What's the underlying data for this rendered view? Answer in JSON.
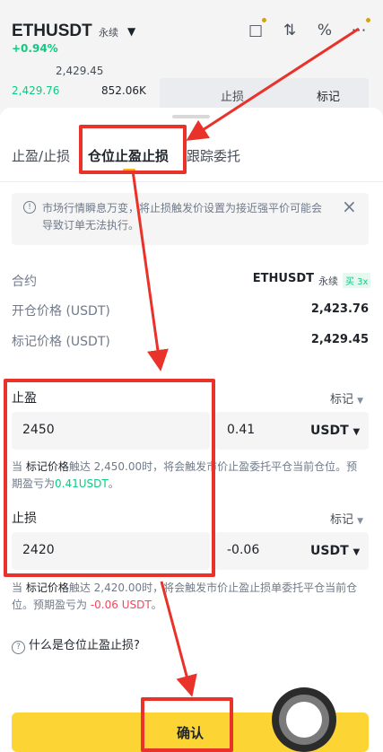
{
  "background": {
    "pair": "ETHUSDT",
    "contract_type": "永续",
    "change": "+0.94%",
    "price_top": "2,429.45",
    "price_bid": "2,429.76",
    "volume": "852.06K",
    "stop_loss_label": "止损",
    "mark_label": "标记",
    "icons": [
      "gift-icon",
      "candlestick-icon",
      "percent-icon",
      "more-icon"
    ]
  },
  "tabs": [
    {
      "label": "止盈/止损"
    },
    {
      "label": "仓位止盈止损"
    },
    {
      "label": "跟踪委托"
    }
  ],
  "notice": {
    "text": "市场行情瞬息万变，将止损触发价设置为接近强平价可能会导致订单无法执行。"
  },
  "info": {
    "contract_label": "合约",
    "contract_value": "ETHUSDT",
    "contract_type": "永续",
    "leverage_badge": "买 3x",
    "entry_label": "开仓价格 (USDT)",
    "entry_value": "2,423.76",
    "mark_label": "标记价格 (USDT)",
    "mark_value": "2,429.45"
  },
  "take_profit": {
    "label": "止盈",
    "trigger_type": "标记",
    "price": "2450",
    "pct": "0.41",
    "unit": "USDT",
    "desc_pre": "当 ",
    "desc_mark": "标记价格",
    "desc_mid": "触达 2,450.00时，将会触发市价止盈委托平仓当前仓位。预期盈亏为",
    "desc_pnl": "0.41USDT",
    "desc_end": "。"
  },
  "stop_loss": {
    "label": "止损",
    "trigger_type": "标记",
    "price": "2420",
    "pct": "-0.06",
    "unit": "USDT",
    "desc_pre": "当 ",
    "desc_mark": "标记价格",
    "desc_mid": "触达 2,420.00时，将会触发市价止盈止损单委托平仓当前仓位。预期盈亏为 ",
    "desc_pnl": "-0.06 USDT",
    "desc_end": "。"
  },
  "help_text": "什么是仓位止盈止损?",
  "confirm_label": "确认",
  "annotation_color": "#e8322a"
}
